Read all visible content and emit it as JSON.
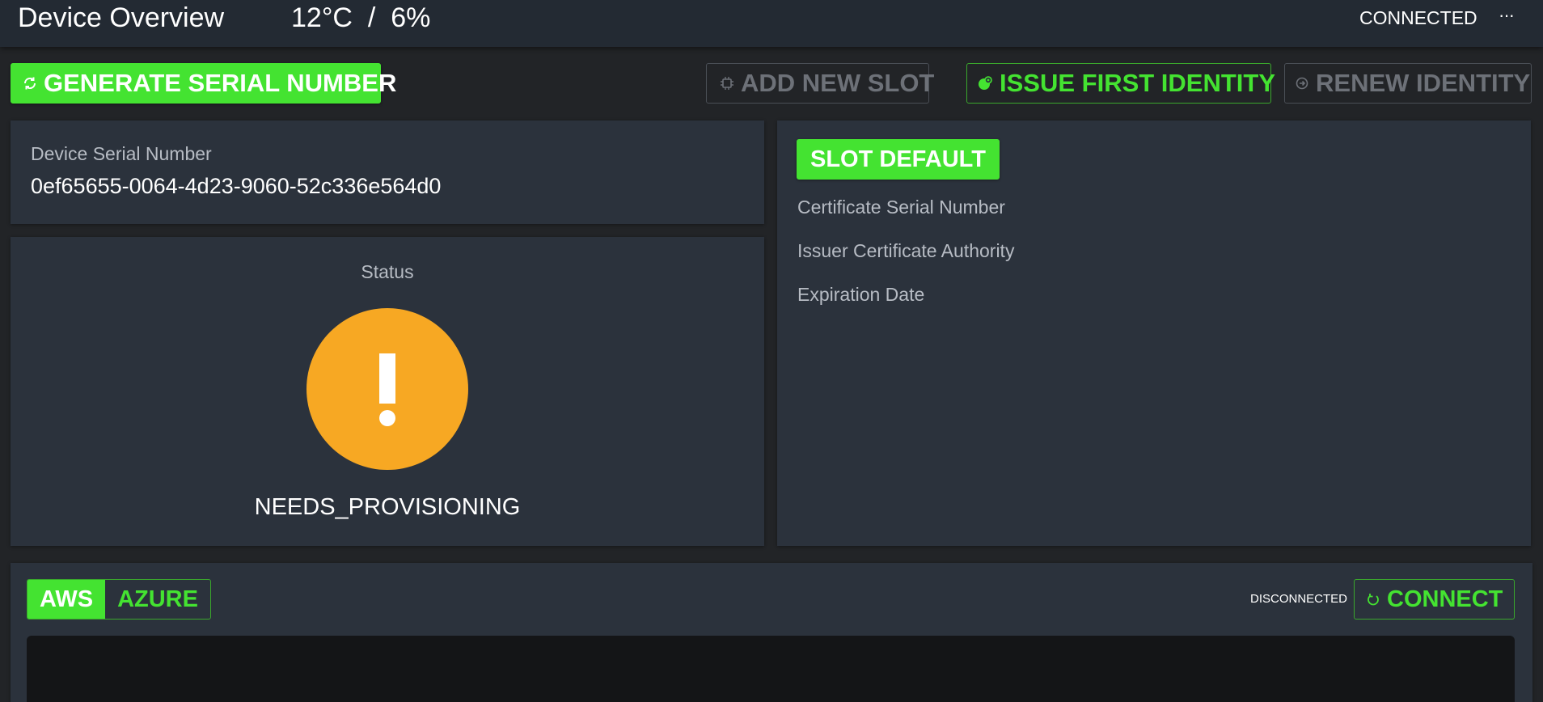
{
  "header": {
    "title": "Device Overview",
    "temperature": "12°C",
    "humidity": "6%",
    "separator": "/",
    "connection_status": "CONNECTED",
    "more_icon": "more-horizontal-icon",
    "more_glyph": "···"
  },
  "toolbar": {
    "generate_serial_label": "GENERATE SERIAL NUMBER",
    "add_slot_label": "ADD NEW SLOT",
    "issue_identity_label": "ISSUE FIRST IDENTITY",
    "renew_identity_label": "RENEW IDENTITY"
  },
  "serial_card": {
    "label": "Device Serial Number",
    "value": "0ef65655-0064-4d23-9060-52c336e564d0"
  },
  "status_card": {
    "label": "Status",
    "icon": "alert-exclamation-icon",
    "value": "NEEDS_PROVISIONING"
  },
  "slot_card": {
    "badge": "SLOT DEFAULT",
    "fields": [
      "Certificate Serial Number",
      "Issuer Certificate Authority",
      "Expiration Date"
    ]
  },
  "cloud": {
    "tabs": [
      "AWS",
      "AZURE"
    ],
    "active_tab": "AWS",
    "status": "DISCONNECTED",
    "connect_label": "CONNECT"
  },
  "colors": {
    "accent_green": "#44e331",
    "warning_orange": "#f7a823",
    "card_bg": "#2b323c",
    "page_bg": "#222427"
  }
}
